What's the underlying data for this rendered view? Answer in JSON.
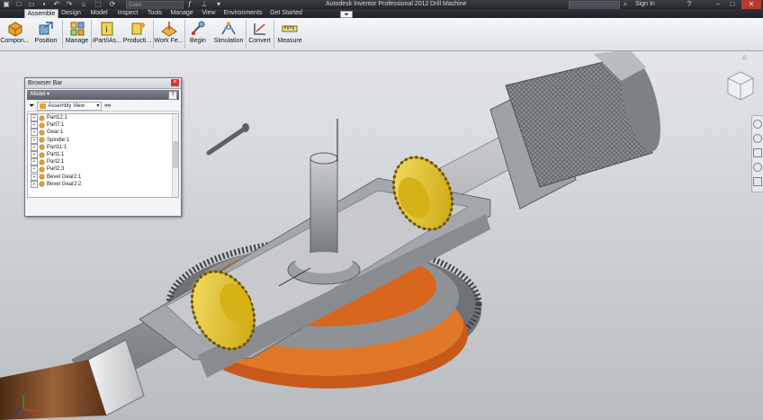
{
  "window": {
    "title": "Autodesk Inventor Professional 2012",
    "document": "Drill Machine",
    "color_combo": "Color",
    "sign_in": "Sign In"
  },
  "tabs": [
    {
      "label": "Assemble",
      "active": true
    },
    {
      "label": "Design"
    },
    {
      "label": "Model"
    },
    {
      "label": "Inspect"
    },
    {
      "label": "Tools"
    },
    {
      "label": "Manage"
    },
    {
      "label": "View"
    },
    {
      "label": "Environments"
    },
    {
      "label": "Get Started"
    }
  ],
  "ribbon": [
    {
      "label": "Compon...",
      "icon": "component-icon"
    },
    {
      "label": "Position",
      "icon": "position-icon"
    },
    {
      "label": "Manage",
      "icon": "manage-icon"
    },
    {
      "label": "iPart/iAs...",
      "icon": "ipart-icon"
    },
    {
      "label": "Producti...",
      "icon": "productivity-icon"
    },
    {
      "label": "Work Fe...",
      "icon": "work-features-icon"
    },
    {
      "label": "Begin",
      "icon": "begin-icon"
    },
    {
      "label": "Simulation",
      "icon": "simulation-icon"
    },
    {
      "label": "Convert",
      "icon": "convert-icon"
    },
    {
      "label": "Measure",
      "icon": "measure-icon"
    }
  ],
  "browser": {
    "title": "Browser Bar",
    "model_dropdown": "Model",
    "view_select": "Assembly View",
    "items": [
      "Part12:1",
      "Part7:1",
      "Gear:1",
      "Spindle:1",
      "Part11:1",
      "Part1:1",
      "Part2:1",
      "Part2:3",
      "Bevel Gear2:1",
      "Bevel Gear2:2"
    ]
  },
  "colors": {
    "ribbon_bg": "#e6e9ed",
    "titlebar_bg": "#2b2e33",
    "part_gray": "#9b9ea3",
    "gear_yellow": "#e6c21a",
    "disc_orange": "#d8661f",
    "handle_wood": "#7a4a2a"
  }
}
